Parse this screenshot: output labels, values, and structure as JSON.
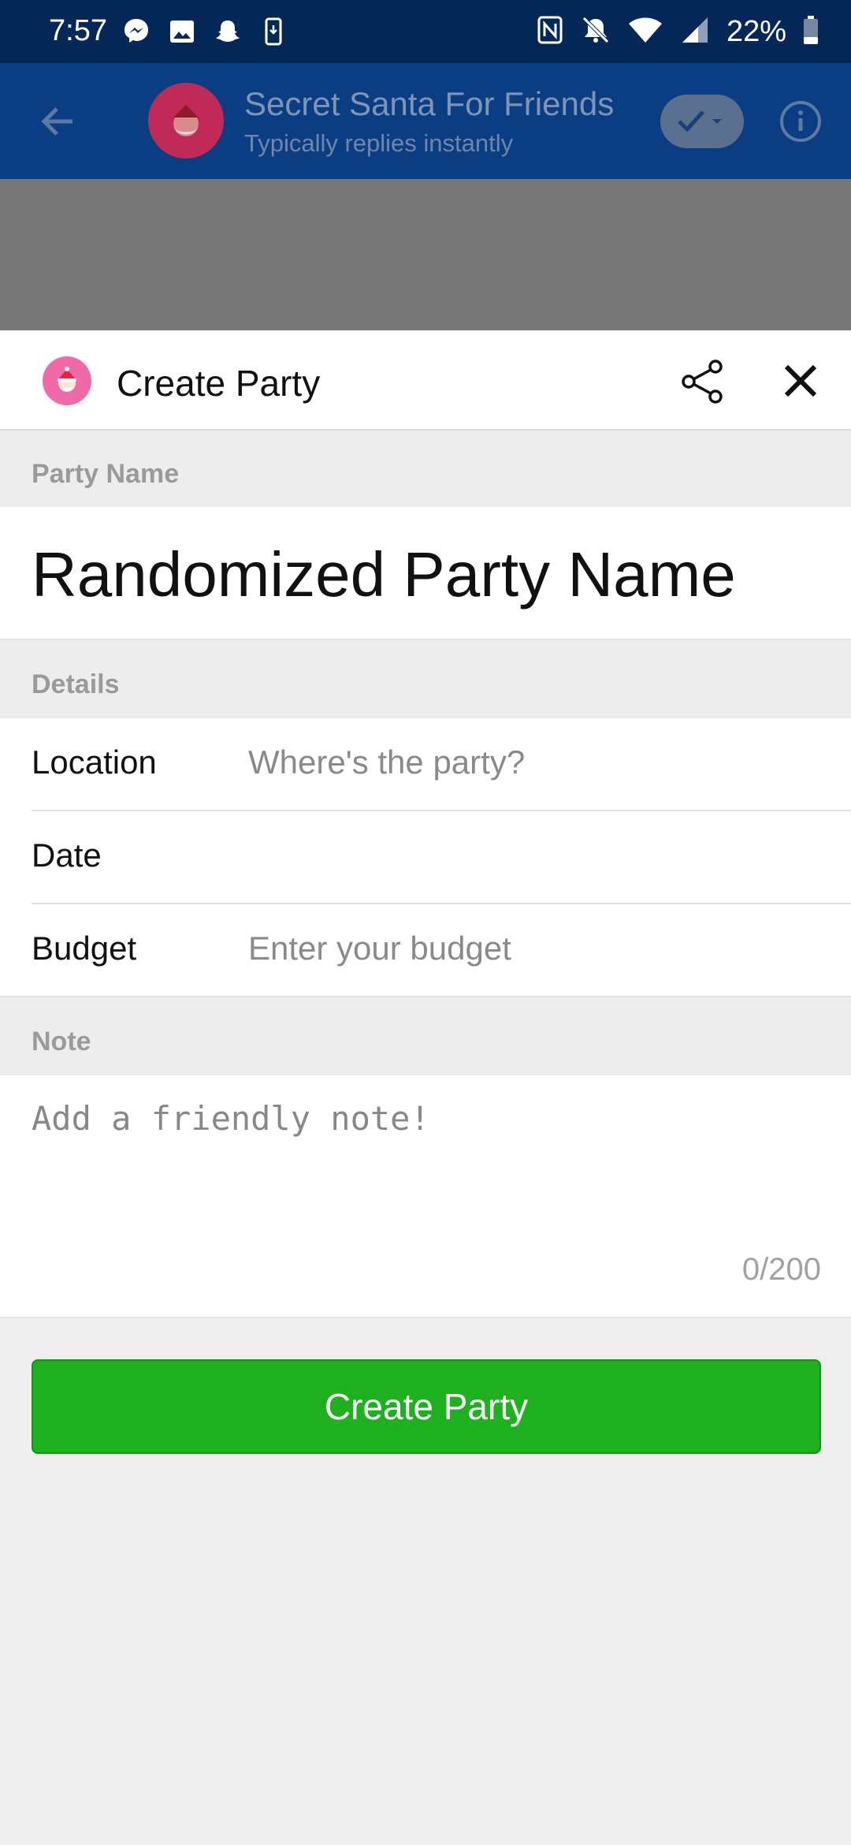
{
  "status_bar": {
    "time": "7:57",
    "battery": "22%",
    "left_icons": [
      "messenger-icon",
      "gallery-icon",
      "snapchat-icon",
      "phone-download-icon"
    ],
    "right_icons": [
      "nfc-icon",
      "bell-off-icon",
      "wifi-icon",
      "signal-icon",
      "battery-icon"
    ]
  },
  "app_bar": {
    "title": "Secret Santa For Friends",
    "subtitle": "Typically replies instantly"
  },
  "sheet": {
    "title": "Create Party",
    "party_name_label": "Party Name",
    "party_name_value": "Randomized Party Name",
    "details_label": "Details",
    "location_label": "Location",
    "location_placeholder": "Where's the party?",
    "date_label": "Date",
    "budget_label": "Budget",
    "budget_placeholder": "Enter your budget",
    "note_label": "Note",
    "note_placeholder": "Add a friendly note!",
    "note_counter": "0/200",
    "create_button": "Create Party"
  },
  "colors": {
    "status_bar": "#052858",
    "app_bar_dimmed": "#0a3d82",
    "primary_button": "#1eb01e",
    "section_bg": "#ededed"
  }
}
